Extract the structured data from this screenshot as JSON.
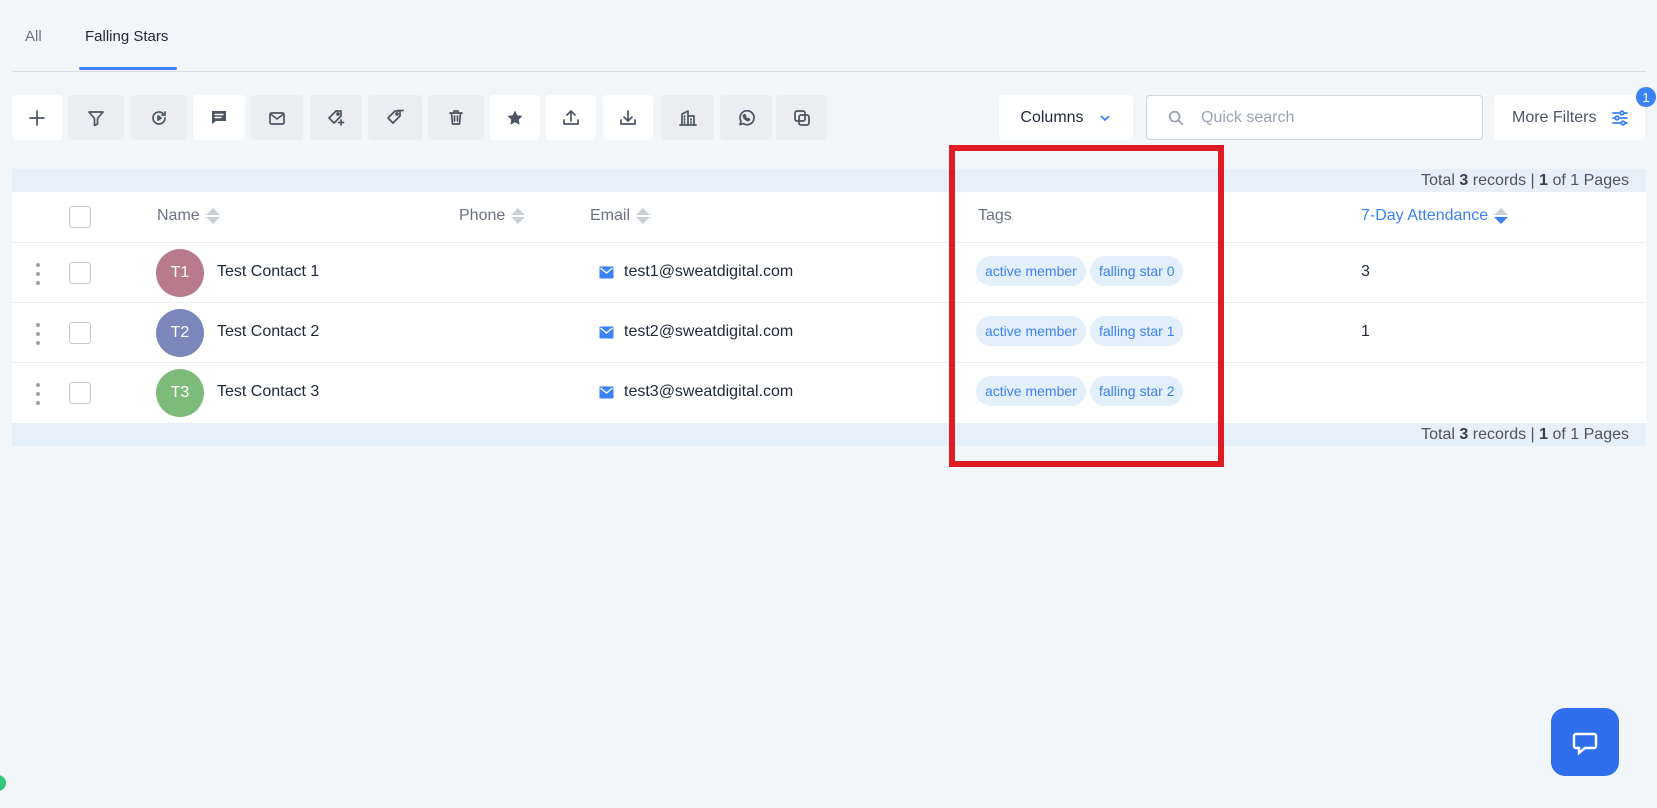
{
  "tabs": [
    {
      "label": "All",
      "active": false
    },
    {
      "label": "Falling Stars",
      "active": true
    }
  ],
  "toolbar": {
    "icons": [
      "plus-icon",
      "filter-icon",
      "automation-icon",
      "sms-icon",
      "email-icon",
      "add-tag-icon",
      "remove-tag-icon",
      "delete-icon",
      "star-icon",
      "export-icon",
      "import-icon",
      "company-icon",
      "whatsapp-icon",
      "merge-icon"
    ],
    "columns_label": "Columns",
    "search_placeholder": "Quick search",
    "more_filters_label": "More Filters",
    "filter_count": "1"
  },
  "pager": {
    "prefix": "Total ",
    "total": "3",
    "records_text": " records | ",
    "page": "1",
    "of_text": " of 1 Pages"
  },
  "table": {
    "columns": [
      "Name",
      "Phone",
      "Email",
      "Tags",
      "7-Day Attendance"
    ],
    "sorted_column": "7-Day Attendance",
    "sort_direction": "desc",
    "rows": [
      {
        "initials": "T1",
        "avatar_color": "#b87a8c",
        "name": "Test Contact 1",
        "phone": "",
        "email": "test1@sweatdigital.com",
        "tags": [
          "active member",
          "falling star 0"
        ],
        "attendance": "3"
      },
      {
        "initials": "T2",
        "avatar_color": "#7b86bb",
        "name": "Test Contact 2",
        "phone": "",
        "email": "test2@sweatdigital.com",
        "tags": [
          "active member",
          "falling star 1"
        ],
        "attendance": "1"
      },
      {
        "initials": "T3",
        "avatar_color": "#7dbb7b",
        "name": "Test Contact 3",
        "phone": "",
        "email": "test3@sweatdigital.com",
        "tags": [
          "active member",
          "falling star 2"
        ],
        "attendance": ""
      }
    ]
  },
  "colors": {
    "accent": "#3b82f6",
    "highlight": "#e01b24",
    "tag_bg": "#e3effb",
    "chat_button": "#2f6fed"
  }
}
